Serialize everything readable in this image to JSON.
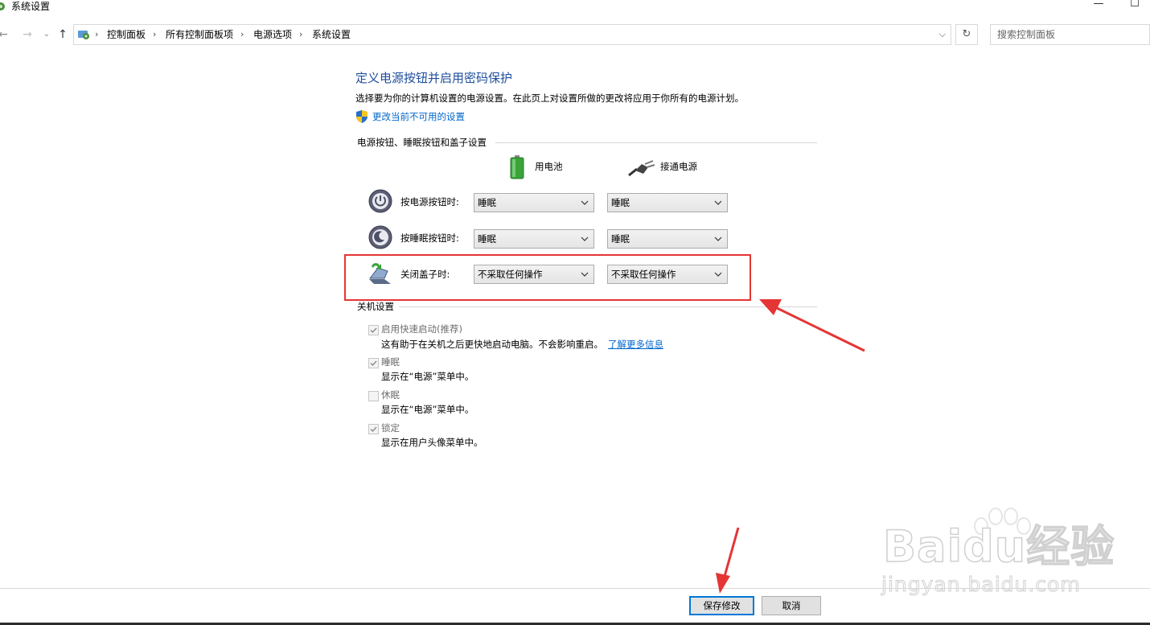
{
  "window": {
    "title": "系统设置"
  },
  "address_bar": {
    "breadcrumbs": [
      "控制面板",
      "所有控制面板项",
      "电源选项",
      "系统设置"
    ]
  },
  "search": {
    "placeholder": "搜索控制面板"
  },
  "main": {
    "heading": "定义电源按钮并启用密码保护",
    "description": "选择要为你的计算机设置的电源设置。在此页上对设置所做的更改将应用于你所有的电源计划。",
    "change_link": "更改当前不可用的设置",
    "power_group": {
      "title": "电源按钮、睡眠按钮和盖子设置",
      "col_battery": "用电池",
      "col_plugged": "接通电源",
      "rows": [
        {
          "label": "按电源按钮时:",
          "battery": "睡眠",
          "plugged": "睡眠",
          "icon": "power-button-icon"
        },
        {
          "label": "按睡眠按钮时:",
          "battery": "睡眠",
          "plugged": "睡眠",
          "icon": "sleep-button-icon"
        },
        {
          "label": "关闭盖子时:",
          "battery": "不采取任何操作",
          "plugged": "不采取任何操作",
          "icon": "laptop-lid-icon"
        }
      ]
    },
    "shutdown_group": {
      "title": "关机设置",
      "items": [
        {
          "title": "启用快速启动(推荐)",
          "desc": "这有助于在关机之后更快地启动电脑。不会影响重启。",
          "link": "了解更多信息",
          "checked": true
        },
        {
          "title": "睡眠",
          "desc": "显示在“电源”菜单中。",
          "checked": true
        },
        {
          "title": "休眠",
          "desc": "显示在“电源”菜单中。",
          "checked": false
        },
        {
          "title": "锁定",
          "desc": "显示在用户头像菜单中。",
          "checked": true
        }
      ]
    }
  },
  "footer": {
    "save": "保存修改",
    "cancel": "取消"
  },
  "watermark": {
    "brand": "Baidu经验",
    "url": "jingyan.baidu.com"
  },
  "colors": {
    "heading": "#1e4e9c",
    "link": "#0066cc",
    "highlight": "#e53535",
    "primary_border": "#0078d7"
  }
}
